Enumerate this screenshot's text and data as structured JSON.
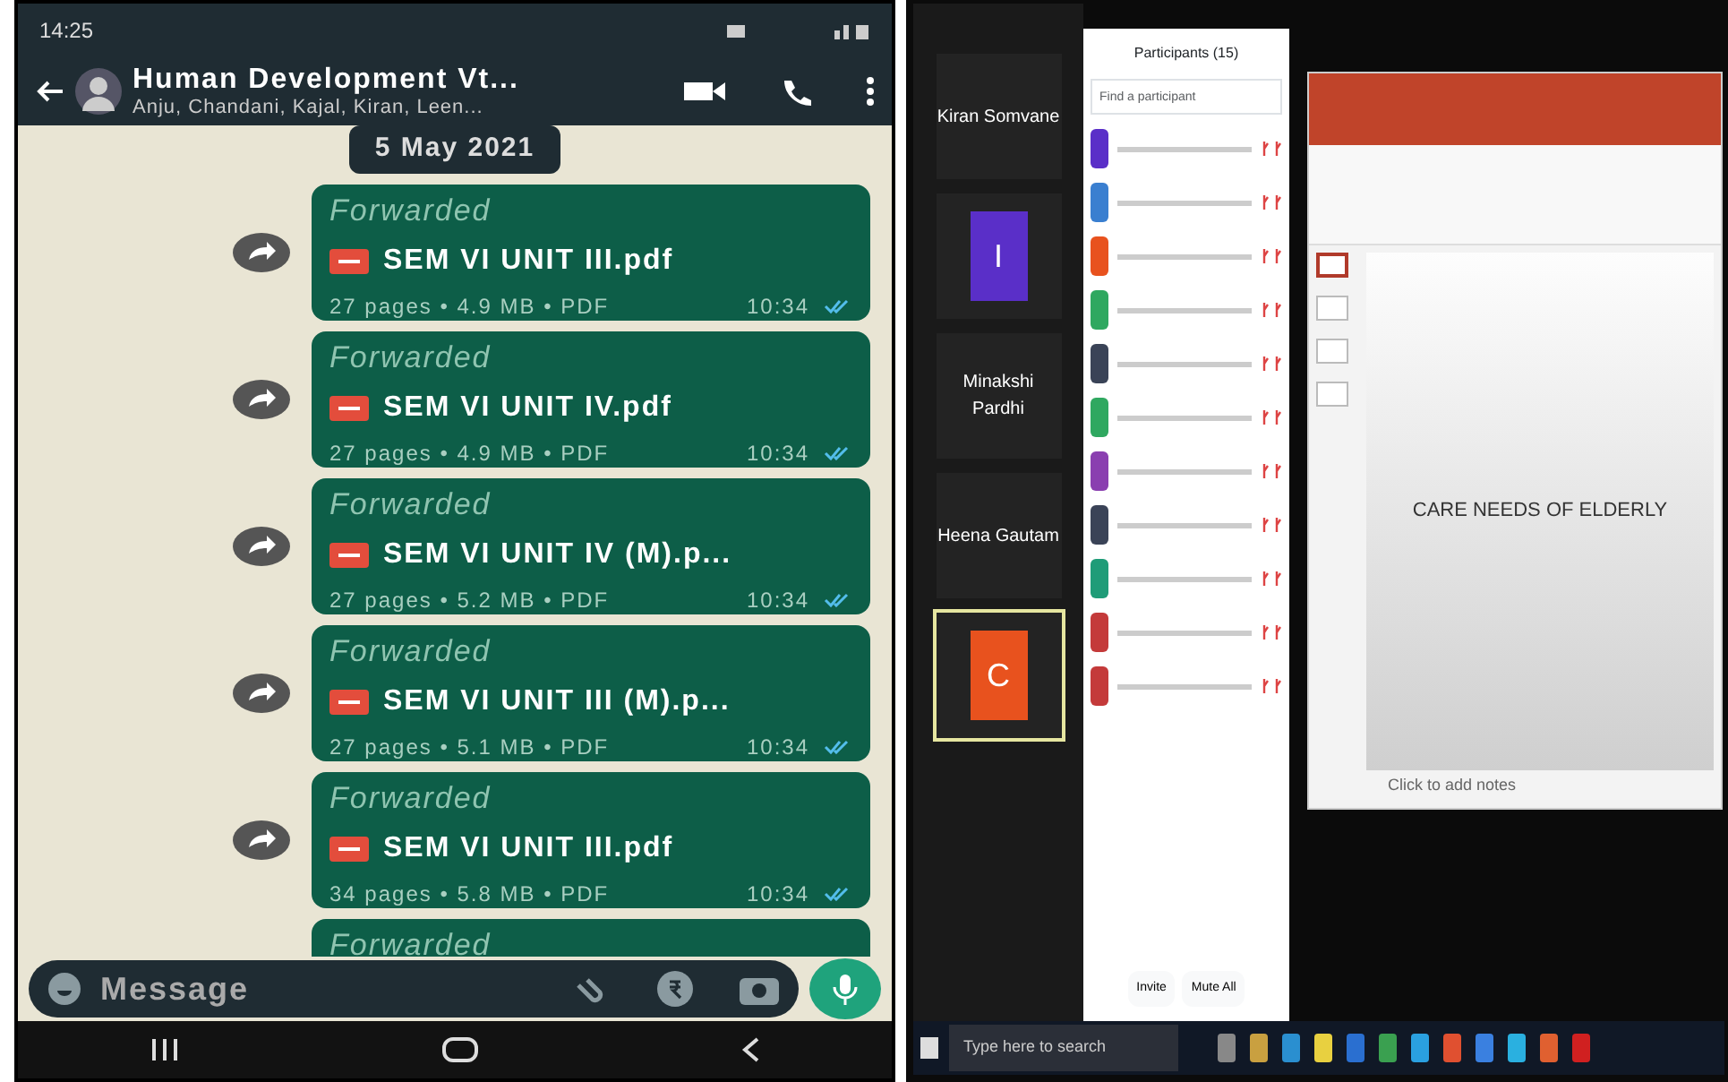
{
  "phone": {
    "status_time": "14:25",
    "chat_title": "Human Development Vt...",
    "chat_subtitle": "Anju, Chandani, Kajal, Kiran, Leen...",
    "date_chip": "5 May 2021",
    "messages": [
      {
        "kind": "file",
        "forwarded": "Forwarded",
        "file_name": "SEM VI UNIT III.pdf",
        "meta": "27 pages • 4.9 MB • PDF",
        "time": "10:34",
        "read": true
      },
      {
        "kind": "file",
        "forwarded": "Forwarded",
        "file_name": "SEM VI UNIT IV.pdf",
        "meta": "27 pages • 4.9 MB • PDF",
        "time": "10:34",
        "read": true
      },
      {
        "kind": "file",
        "forwarded": "Forwarded",
        "file_name": "SEM VI UNIT IV (M).p...",
        "meta": "27 pages • 5.2 MB • PDF",
        "time": "10:34",
        "read": true
      },
      {
        "kind": "file",
        "forwarded": "Forwarded",
        "file_name": "SEM VI UNIT III (M).p...",
        "meta": "27 pages • 5.1 MB • PDF",
        "time": "10:34",
        "read": true
      },
      {
        "kind": "file",
        "forwarded": "Forwarded",
        "file_name": "SEM VI UNIT III.pdf",
        "meta": "34 pages • 5.8 MB • PDF",
        "time": "10:34",
        "read": true
      },
      {
        "kind": "partial",
        "forwarded": "Forwarded"
      }
    ],
    "input": {
      "placeholder": "Message"
    }
  },
  "meeting": {
    "tiles": [
      {
        "kind": "name",
        "name": "Kiran Somvane",
        "selected": false
      },
      {
        "kind": "avatar",
        "initial": "I",
        "color": "#5a2fc8",
        "selected": false
      },
      {
        "kind": "name",
        "name": "Minakshi Pardhi",
        "selected": false
      },
      {
        "kind": "name",
        "name": "Heena Gautam",
        "selected": false
      },
      {
        "kind": "avatar",
        "initial": "C",
        "color": "#e8521e",
        "selected": true
      }
    ],
    "participants_title": "Participants (15)",
    "participants_search": {
      "placeholder": "Find a participant"
    },
    "participants": [
      {
        "color": "#5a2fc8"
      },
      {
        "color": "#3a7fd0"
      },
      {
        "color": "#e8521e"
      },
      {
        "color": "#2fa860"
      },
      {
        "color": "#3a4357"
      },
      {
        "color": "#2fa860"
      },
      {
        "color": "#8a3fb0"
      },
      {
        "color": "#3a4357"
      },
      {
        "color": "#1f9c78"
      },
      {
        "color": "#c43a3a"
      },
      {
        "color": "#c43a3a"
      }
    ],
    "buttons": [
      "Invite",
      "Mute All"
    ]
  },
  "slides": {
    "slide_title": "CARE NEEDS OF ELDERLY",
    "notes": "Click to add notes",
    "thumbnails": [
      {
        "selected": true
      },
      {
        "selected": false
      },
      {
        "selected": false
      },
      {
        "selected": false
      }
    ]
  },
  "taskbar": {
    "search": "Type here to search",
    "apps": [
      {
        "color": "#888888"
      },
      {
        "color": "#c9a040"
      },
      {
        "color": "#2a8fd0"
      },
      {
        "color": "#e8d040"
      },
      {
        "color": "#2a6fd0"
      },
      {
        "color": "#3aa050"
      },
      {
        "color": "#2aa0e0"
      },
      {
        "color": "#e05030"
      },
      {
        "color": "#3a80e0"
      },
      {
        "color": "#2ab0e0"
      },
      {
        "color": "#e06030"
      },
      {
        "color": "#d02020"
      }
    ]
  }
}
